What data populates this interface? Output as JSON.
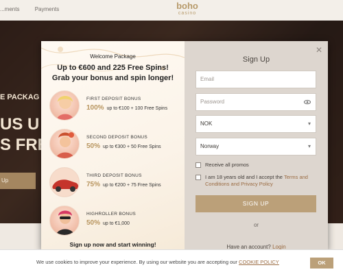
{
  "site": {
    "nav": [
      "...ments",
      "Payments"
    ],
    "logo_main": "boho",
    "logo_sub": "casino",
    "hero_line1": "E PACKAG",
    "hero_line2": "US U",
    "hero_line3": "S FRE",
    "hero_button": "Up"
  },
  "modal": {
    "promo": {
      "title": "Welcome Package",
      "headline_1": "Up to €600 and 225 Free Spins!",
      "headline_2": "Grab your bonus and spin longer!",
      "bonuses": [
        {
          "label": "FIRST DEPOSIT BONUS",
          "percent": "100%",
          "detail": "up to €100 + 100 Free Spins"
        },
        {
          "label": "SECOND DEPOSIT BONUS",
          "percent": "50%",
          "detail": "up to €300 + 50 Free Spins"
        },
        {
          "label": "THIRD DEPOSIT BONUS",
          "percent": "75%",
          "detail": "up to €200 + 75 Free Spins"
        },
        {
          "label": "HIGHROLLER BONUS",
          "percent": "50%",
          "detail": "up to €1,000"
        }
      ],
      "footer": "Sign up now and start winning!"
    },
    "form": {
      "close": "✕",
      "title": "Sign Up",
      "email_placeholder": "Email",
      "password_placeholder": "Password",
      "currency_value": "NOK",
      "country_value": "Norway",
      "promo_checkbox": "Receive all promos",
      "terms_text": "I am 18 years old and I accept the ",
      "terms_link": "Terms and Conditions and Privacy Policy",
      "signup_button": "SIGN UP",
      "or": "or",
      "have_account": "Have an account? ",
      "login_link": "Login"
    }
  },
  "cookie": {
    "text": "We use cookies to improve your experience. By using our website you are accepting our ",
    "link": "COOKIE POLICY",
    "ok": "OK"
  },
  "colors": {
    "accent": "#bba079",
    "link": "#9a6b42",
    "percent": "#b8955f"
  }
}
